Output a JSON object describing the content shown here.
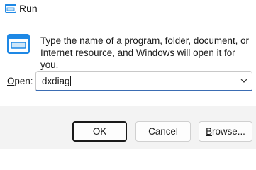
{
  "window": {
    "title": "Run",
    "title_icon": "run-icon"
  },
  "content": {
    "icon": "run-icon",
    "description": "Type the name of a program, folder, document, or Internet resource, and Windows will open it for you.",
    "open_label_prefix": "O",
    "open_label_rest": "pen:",
    "open_value": "dxdiag"
  },
  "buttons": {
    "ok": "OK",
    "cancel": "Cancel",
    "browse_prefix": "B",
    "browse_rest": "rowse..."
  },
  "colors": {
    "accent": "#3b6db3",
    "icon_blue": "#1e88e5"
  }
}
